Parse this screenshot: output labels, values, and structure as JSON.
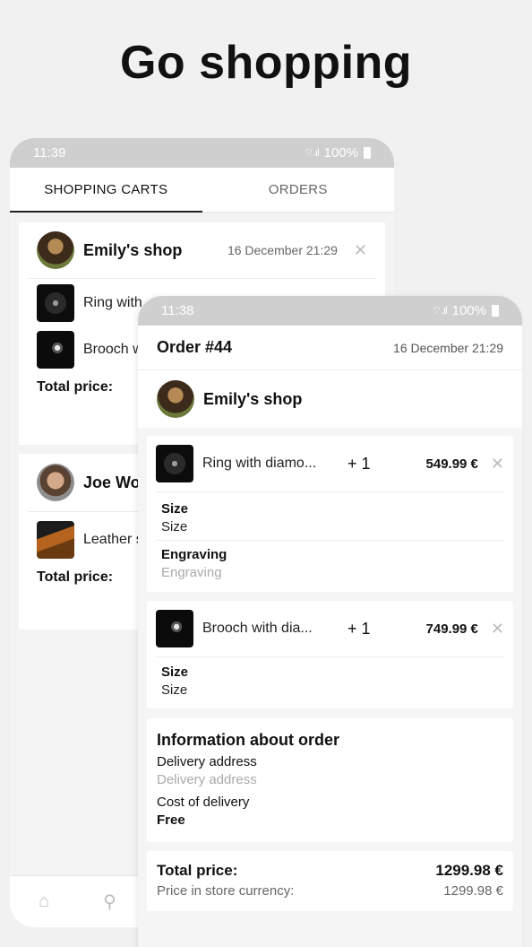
{
  "headline": "Go shopping",
  "back_phone": {
    "status": {
      "time": "11:39",
      "battery": "100%"
    },
    "tabs": [
      {
        "label": "SHOPPING CARTS",
        "active": true
      },
      {
        "label": "ORDERS",
        "active": false
      }
    ],
    "carts": [
      {
        "shop": "Emily's shop",
        "date": "16 December 21:29",
        "items": [
          {
            "name": "Ring with",
            "thumb": "ring"
          },
          {
            "name": "Brooch w",
            "thumb": "brooch"
          }
        ],
        "total_label": "Total price:"
      },
      {
        "shop": "Joe Wo",
        "items": [
          {
            "name": "Leather s",
            "thumb": "shoes"
          }
        ],
        "total_label": "Total price:"
      }
    ],
    "nav_icons": [
      "home-icon",
      "search-icon"
    ]
  },
  "front_phone": {
    "status": {
      "time": "11:38",
      "battery": "100%"
    },
    "order": {
      "title": "Order #44",
      "date": "16 December 21:29",
      "shop": "Emily's shop"
    },
    "items": [
      {
        "name": "Ring with diamo...",
        "qty": "+ 1",
        "price": "549.99 €",
        "attributes": [
          {
            "label": "Size",
            "value": "Size",
            "placeholder": false
          },
          {
            "label": "Engraving",
            "value": "Engraving",
            "placeholder": true
          }
        ]
      },
      {
        "name": "Brooch with dia...",
        "qty": "+ 1",
        "price": "749.99 €",
        "attributes": [
          {
            "label": "Size",
            "value": "Size",
            "placeholder": false
          }
        ]
      }
    ],
    "info": {
      "title": "Information about order",
      "delivery_label": "Delivery address",
      "delivery_placeholder": "Delivery address",
      "cost_label": "Cost of delivery",
      "cost_value": "Free"
    },
    "totals": {
      "label": "Total price:",
      "value": "1299.98 €",
      "store_label": "Price in store currency:",
      "store_value": "1299.98 €"
    }
  }
}
